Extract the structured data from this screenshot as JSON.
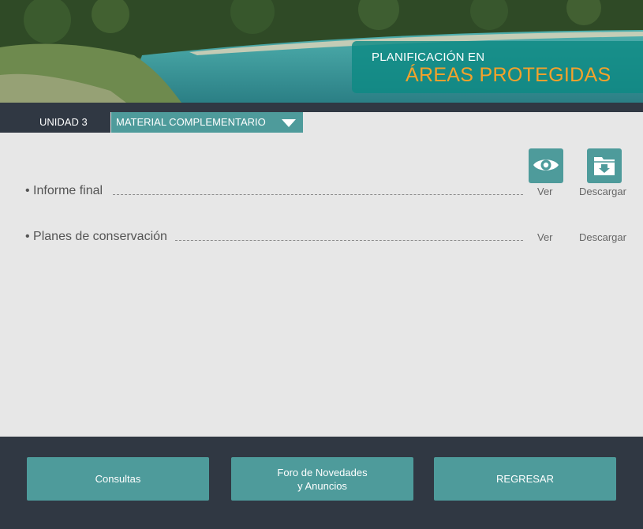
{
  "header": {
    "title_line1": "PLANIFICACIÓN EN",
    "title_line2": "ÁREAS PROTEGIDAS"
  },
  "nav": {
    "unit_label": "UNIDAD 3",
    "section_label": "MATERIAL COMPLEMENTARIO",
    "section_icon": "caret-down-icon"
  },
  "materials": {
    "view_icon": "eye-icon",
    "download_icon": "download-folder-icon",
    "items": [
      {
        "label": "• Informe final",
        "view_label": "Ver",
        "download_label": "Descargar"
      },
      {
        "label": "• Planes de conservación",
        "view_label": "Ver",
        "download_label": "Descargar"
      }
    ]
  },
  "footer": {
    "consultas_label": "Consultas",
    "foro_label": "Foro de Novedades\ny Anuncios",
    "regresar_label": "REGRESAR"
  },
  "colors": {
    "dark_bar": "#303843",
    "teal": "#4e9b9b",
    "title_accent": "#f4a22b",
    "content_bg": "#e7e7e7"
  }
}
